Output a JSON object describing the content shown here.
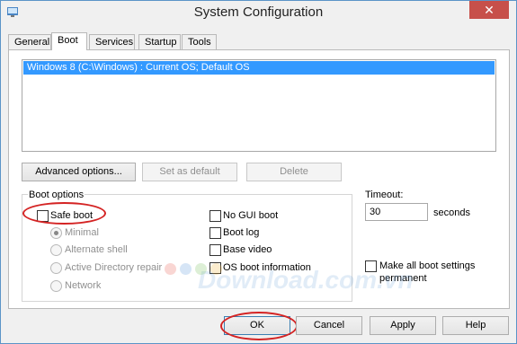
{
  "window": {
    "title": "System Configuration",
    "close_glyph": "✕"
  },
  "tabs": [
    {
      "label": "General"
    },
    {
      "label": "Boot"
    },
    {
      "label": "Services"
    },
    {
      "label": "Startup"
    },
    {
      "label": "Tools"
    }
  ],
  "os_list": {
    "entries": [
      "Windows 8 (C:\\Windows) : Current OS; Default OS"
    ]
  },
  "list_buttons": {
    "advanced": "Advanced options...",
    "set_default": "Set as default",
    "delete": "Delete"
  },
  "boot_options": {
    "label": "Boot options",
    "safe_boot": "Safe boot",
    "minimal": "Minimal",
    "alternate_shell": "Alternate shell",
    "active_directory_repair": "Active Directory repair",
    "network": "Network",
    "no_gui_boot": "No GUI boot",
    "boot_log": "Boot log",
    "base_video": "Base video",
    "os_boot_information": "OS boot information"
  },
  "timeout": {
    "label": "Timeout:",
    "value": "30",
    "unit": "seconds"
  },
  "permanent": {
    "label_line1": "Make all boot settings",
    "label_line2": "permanent"
  },
  "dialog_buttons": {
    "ok": "OK",
    "cancel": "Cancel",
    "apply": "Apply",
    "help": "Help"
  },
  "watermark": {
    "text": "Download.com.vn"
  },
  "colors": {
    "selection": "#3399ff",
    "highlight_oval": "#d42323",
    "close_button": "#c7504a"
  }
}
